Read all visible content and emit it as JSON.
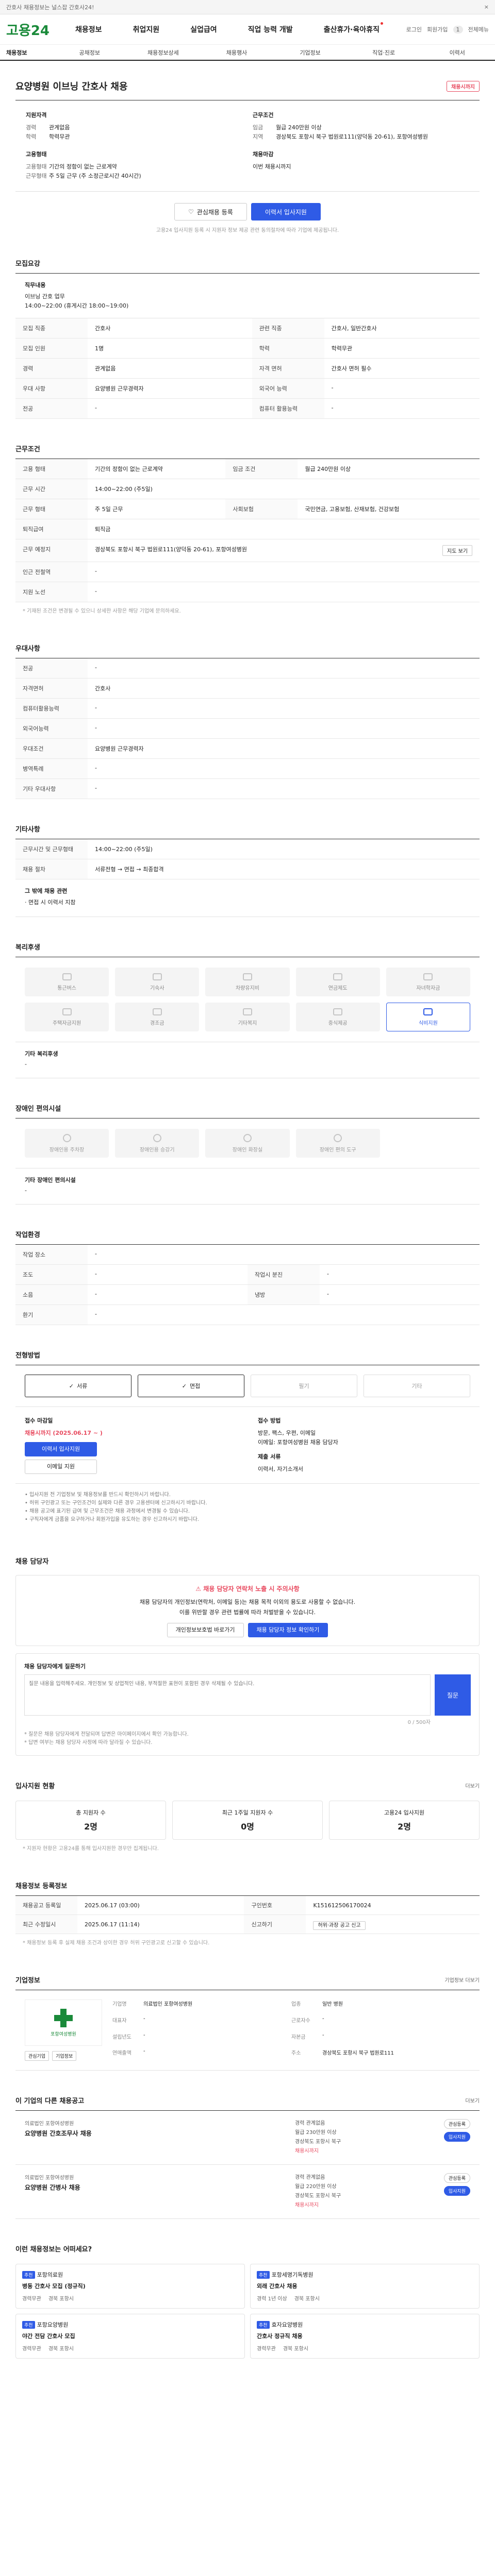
{
  "topbar": {
    "text": "간호사 채용정보는 널스잡 간호사24!",
    "close": "×"
  },
  "header": {
    "logo": "고용24",
    "nav": [
      "채용정보",
      "취업지원",
      "실업급여",
      "직업 능력 개발",
      "출산휴가·육아휴직"
    ],
    "util": {
      "login": "로그인",
      "join": "회원가입",
      "menu": "전체메뉴",
      "bubble": "1"
    }
  },
  "breadcrumb": [
    "채용정보",
    "공채정보",
    "채용정보상세",
    "채용행사",
    "기업정보",
    "직업·진로",
    "이력서"
  ],
  "job": {
    "title": "요양병원 이브닝 간호사 채용",
    "tag": "채용시까지",
    "qual": {
      "heading": "지원자격",
      "rows": [
        [
          "경력",
          "관계없음"
        ],
        [
          "학력",
          "학력무관"
        ]
      ]
    },
    "cond": {
      "heading": "근무조건",
      "rows": [
        [
          "임금",
          "월급 240만원 이상"
        ],
        [
          "지역",
          "경상북도 포항시 북구 법원로111(양덕동 20-61), 포항여성병원"
        ]
      ]
    },
    "form": {
      "heading": "고용형태",
      "rows": [
        [
          "고용형태",
          "기간의 정함이 없는 근로계약"
        ],
        [
          "근무형태",
          "주 5일 근무 (주 소정근로시간 40시간)"
        ]
      ]
    },
    "deadline": {
      "heading": "채용마감",
      "value": "이번 채용시까지"
    },
    "btn_scrap": "관심채용 등록",
    "btn_apply": "이력서 입사지원",
    "note": "고용24 입사지원 등록 시 지원자 정보 제공 관련 동의절차에 따라 기업에 제공됩니다."
  },
  "recruit": {
    "heading": "모집요강",
    "intro_label": "직무내용",
    "intro": "이브닝 간호 업무\n14:00~22:00 (휴게시간 18:00~19:00)",
    "rows": [
      {
        "k": "모집 직종",
        "v": "간호사"
      },
      {
        "k": "관련 직종",
        "v": "간호사, 일반간호사"
      },
      {
        "k": "모집 인원",
        "v": "1명"
      },
      {
        "k": "학력",
        "v": "학력무관"
      },
      {
        "k": "경력",
        "v": "관계없음"
      },
      {
        "k": "자격 면허",
        "v": "간호사 면허 필수"
      },
      {
        "k": "우대 사항",
        "v": "요양병원 근무경력자"
      },
      {
        "k": "외국어 능력",
        "v": "-"
      },
      {
        "k": "전공",
        "v": "-"
      },
      {
        "k": "컴퓨터 활용능력",
        "v": "-"
      }
    ]
  },
  "workcond": {
    "heading": "근무조건",
    "rows": [
      {
        "k": "고용 형태",
        "v": "기간의 정함이 없는 근로계약"
      },
      {
        "k": "임금 조건",
        "v": "월급 240만원 이상"
      },
      {
        "k": "근무 시간",
        "v": "14:00~22:00 (주5일)"
      },
      {
        "k": "근무 형태",
        "v": "주 5일 근무"
      },
      {
        "k": "사회보험",
        "v": "국민연금, 고용보험, 산재보험, 건강보험"
      },
      {
        "k": "퇴직급여",
        "v": "퇴직금"
      },
      {
        "k": "근무 예정지",
        "v": "경상북도 포항시 북구 법원로111(양덕동 20-61), 포항여성병원"
      },
      {
        "k": "인근 전철역",
        "v": "-"
      },
      {
        "k": "지원 노선",
        "v": "-"
      }
    ],
    "map_btn": "지도 보기",
    "note": "* 기재된 조건은 변경될 수 있으니 상세한 사항은 해당 기업에 문의하세요."
  },
  "pref": {
    "heading": "우대사항",
    "rows": [
      {
        "k": "전공",
        "v": "-"
      },
      {
        "k": "자격면허",
        "v": "간호사"
      },
      {
        "k": "컴퓨터활용능력",
        "v": "-"
      },
      {
        "k": "외국어능력",
        "v": "-"
      },
      {
        "k": "우대조건",
        "v": "요양병원 근무경력자"
      },
      {
        "k": "병역특례",
        "v": "-"
      },
      {
        "k": "기타 우대사항",
        "v": "-"
      }
    ]
  },
  "etc": {
    "heading": "기타사항",
    "rows": [
      {
        "k": "근무시간 및 근무형태",
        "v": "14:00~22:00 (주5일)"
      },
      {
        "k": "채용 절차",
        "v": "서류전형 → 면접 → 최종합격"
      }
    ],
    "extra_label": "그 밖에 채용 관련",
    "extra": "· 면접 시 이력서 지참"
  },
  "welfare": {
    "heading": "복리후생",
    "items": [
      {
        "label": "통근버스",
        "on": false
      },
      {
        "label": "기숙사",
        "on": false
      },
      {
        "label": "차량유지비",
        "on": false
      },
      {
        "label": "연금제도",
        "on": false
      },
      {
        "label": "자녀학자금",
        "on": false
      },
      {
        "label": "주택자금지원",
        "on": false
      },
      {
        "label": "경조금",
        "on": false
      },
      {
        "label": "기타복지",
        "on": false
      },
      {
        "label": "중식제공",
        "on": false
      },
      {
        "label": "식비지원",
        "on": true
      }
    ],
    "extra_label": "기타 복리후생",
    "extra": "-"
  },
  "disabled": {
    "heading": "장애인 편의시설",
    "items": [
      "장애인용 주차장",
      "장애인용 승강기",
      "장애인 화장실",
      "장애인 편의 도구"
    ],
    "extra_label": "기타 장애인 편의시설",
    "extra": "-"
  },
  "work_env": {
    "heading": "작업환경",
    "rows": [
      {
        "k": "작업 장소",
        "v": "-",
        "k2": "",
        "v2": ""
      },
      {
        "k": "조도",
        "v": "-",
        "k2": "작업시 분진",
        "v2": "-"
      },
      {
        "k": "소음",
        "v": "-",
        "k2": "냉방",
        "v2": "-"
      },
      {
        "k": "환기",
        "v": "-",
        "k2": "",
        "v2": ""
      }
    ]
  },
  "apply": {
    "heading": "전형방법",
    "methods": [
      {
        "label": "서류",
        "on": true
      },
      {
        "label": "면접",
        "on": true
      },
      {
        "label": "필기",
        "on": false
      },
      {
        "label": "기타",
        "on": false
      }
    ],
    "recv_h": "접수 마감일",
    "recv_date": "채용시까지 (2025.06.17 ~ )",
    "recv_btn": "이력서 입사지원",
    "recv_btn2": "이메일 지원",
    "submit_h": "접수 방법",
    "submit_lines": [
      "방문, 팩스, 우편, 이메일",
      "이메일: 포항여성병원 채용 담당자"
    ],
    "note_h": "제출 서류",
    "note_lines": [
      "이력서, 자기소개서"
    ],
    "bullets": [
      "입사지원 전 기업정보 및 채용정보를 반드시 확인하시기 바랍니다.",
      "허위 구인광고 또는 구인조건이 실제와 다른 경우 고용센터에 신고하시기 바랍니다.",
      "채용 공고에 표기된 급여 및 근무조건은 채용 과정에서 변경될 수 있습니다.",
      "구직자에게 금품을 요구하거나 회원가입을 유도하는 경우 신고하시기 바랍니다."
    ]
  },
  "contact": {
    "heading": "채용 담당자",
    "warn_title": "채용 담당자 연락처 노출 시 주의사항",
    "warn_lines": [
      "채용 담당자의 개인정보(연락처, 이메일 등)는 채용 목적 이외의 용도로 사용할 수 없습니다.",
      "이를 위반할 경우 관련 법률에 따라 처벌받을 수 있습니다."
    ],
    "warn_btn1": "개인정보보호법 바로가기",
    "warn_btn2": "채용 담당자 정보 확인하기",
    "ask_h": "채용 담당자에게 질문하기",
    "ask_placeholder": "질문 내용을 입력해주세요. 개인정보 및 상업적인 내용, 부적절한 표현이 포함된 경우 삭제될 수 있습니다.",
    "ask_submit": "질문",
    "ask_count": "0 / 500자",
    "ask_notes": [
      "* 질문은 채용 담당자에게 전달되며 답변은 마이페이지에서 확인 가능합니다.",
      "* 답변 여부는 채용 담당자 사정에 따라 달라질 수 있습니다."
    ]
  },
  "stats": {
    "heading": "입사지원 현황",
    "more": "더보기",
    "items": [
      {
        "label": "총 지원자 수",
        "value": "2명"
      },
      {
        "label": "최근 1주일 지원자 수",
        "value": "0명"
      },
      {
        "label": "고용24 입사지원",
        "value": "2명"
      }
    ],
    "note": "* 지원자 현황은 고용24를 통해 입사지원한 경우만 집계됩니다."
  },
  "postinfo": {
    "heading": "채용정보 등록정보",
    "more": "",
    "rows": [
      {
        "k": "채용공고 등록일",
        "v": "2025.06.17 (03:00)",
        "k2": "구인번호",
        "v2": "K151612506170024"
      },
      {
        "k": "최근 수정일시",
        "v": "2025.06.17 (11:14)",
        "k2": "신고하기",
        "v2": "허위·과장 공고 신고"
      }
    ],
    "note": "* 채용정보 등록 후 실제 채용 조건과 상이한 경우 허위 구인광고로 신고할 수 있습니다."
  },
  "company": {
    "heading": "기업정보",
    "more": "기업정보 더보기",
    "logo_text": "포항여성병원",
    "btns": [
      "관심기업",
      "기업정보"
    ],
    "info": [
      {
        "k": "기업명",
        "v": "의료법인 포항여성병원"
      },
      {
        "k": "업종",
        "v": "일반 병원"
      },
      {
        "k": "대표자",
        "v": "-"
      },
      {
        "k": "근로자수",
        "v": "-"
      },
      {
        "k": "설립년도",
        "v": "-"
      },
      {
        "k": "자본금",
        "v": "-"
      },
      {
        "k": "연매출액",
        "v": "-"
      },
      {
        "k": "주소",
        "v": "경상북도 포항시 북구 법원로111"
      }
    ]
  },
  "other_posts": {
    "heading": "이 기업의 다른 채용공고",
    "more": "더보기",
    "items": [
      {
        "org": "의료법인 포항여성병원",
        "title": "요양병원 간호조무사 채용",
        "meta": [
          "경력 관계없음",
          "월급 230만원 이상",
          "경상북도 포항시 북구"
        ],
        "dday": "채용시까지"
      },
      {
        "org": "의료법인 포항여성병원",
        "title": "요양병원 간병사 채용",
        "meta": [
          "경력 관계없음",
          "월급 220만원 이상",
          "경상북도 포항시 북구"
        ],
        "dday": "채용시까지"
      }
    ],
    "act_scrap": "관심등록",
    "act_apply": "입사지원"
  },
  "recommend": {
    "heading": "이런 채용정보는 어떠세요?",
    "items": [
      {
        "lab": "추천",
        "org": "포항의료원",
        "title": "병동 간호사 모집 (정규직)",
        "m1": "경력무관",
        "m2": "경북 포항시"
      },
      {
        "lab": "추천",
        "org": "포항세명기독병원",
        "title": "외래 간호사 채용",
        "m1": "경력 1년 이상",
        "m2": "경북 포항시"
      },
      {
        "lab": "추천",
        "org": "포항요양병원",
        "title": "야간 전담 간호사 모집",
        "m1": "경력무관",
        "m2": "경북 포항시"
      },
      {
        "lab": "추천",
        "org": "효자요양병원",
        "title": "간호사 정규직 채용",
        "m1": "경력무관",
        "m2": "경북 포항시"
      }
    ]
  }
}
